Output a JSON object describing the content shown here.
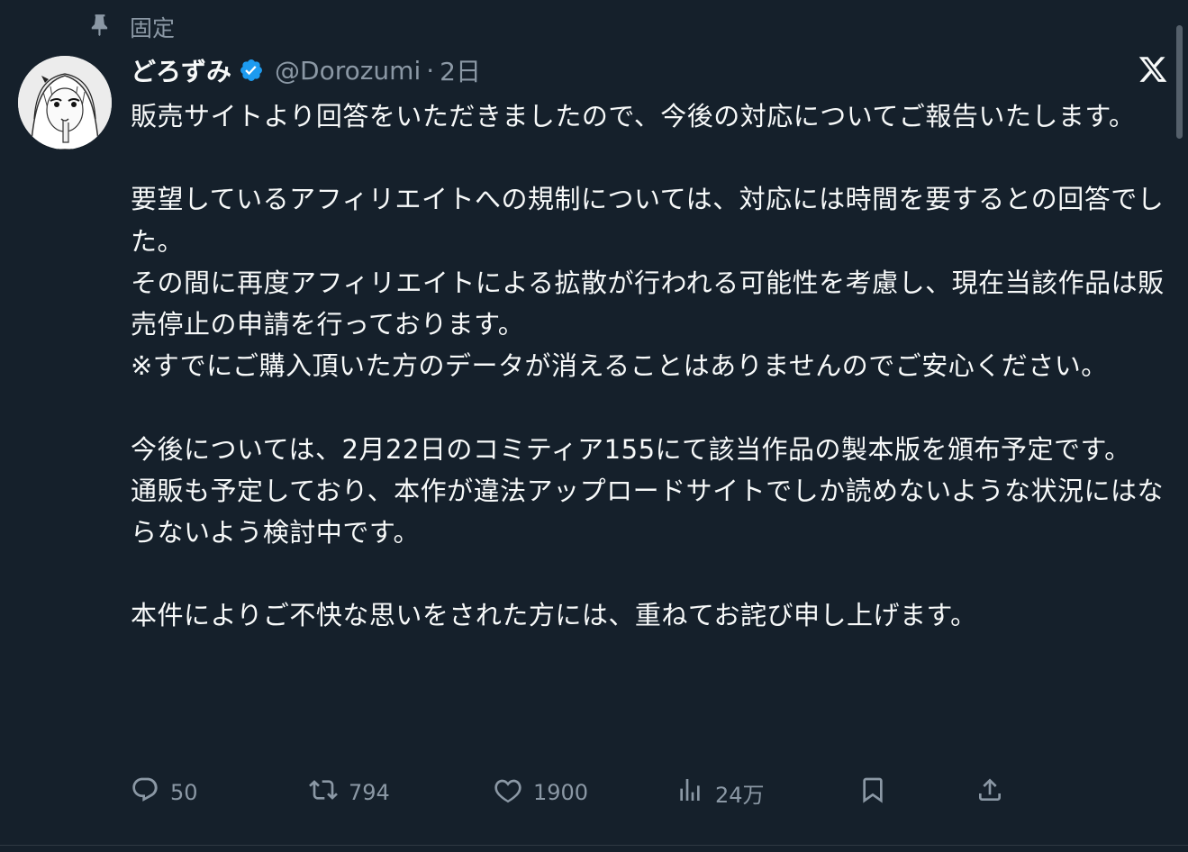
{
  "pinned": {
    "label": "固定"
  },
  "author": {
    "display_name": "どろずみ",
    "handle": "@Dorozumi",
    "separator": "·",
    "time": "2日",
    "verified": true
  },
  "tweet": {
    "paragraphs": [
      "販売サイトより回答をいただきましたので、今後の対応についてご報告いたします。",
      "",
      "要望しているアフィリエイトへの規制については、対応には時間を要するとの回答でした。",
      "その間に再度アフィリエイトによる拡散が行われる可能性を考慮し、現在当該作品は販売停止の申請を行っております。",
      "※すでにご購入頂いた方のデータが消えることはありませんのでご安心ください。",
      "",
      "今後については、2月22日のコミティア155にて該当作品の製本版を頒布予定です。",
      "通販も予定しており、本作が違法アップロードサイトでしか読めないような状況にはならないよう検討中です。",
      "",
      "本件によりご不快な思いをされた方には、重ねてお詫び申し上げます。"
    ]
  },
  "actions": {
    "reply_count": "50",
    "retweet_count": "794",
    "like_count": "1900",
    "views_count": "24万"
  },
  "icons": {
    "pin": "pin-icon",
    "verified": "verified-badge-icon",
    "brand": "x-logo-icon",
    "reply": "reply-icon",
    "retweet": "retweet-icon",
    "like": "heart-icon",
    "views": "views-icon",
    "bookmark": "bookmark-icon",
    "share": "share-icon"
  },
  "colors": {
    "background": "#15202b",
    "text": "#f7f9f9",
    "secondary": "#8b98a5",
    "verified": "#1d9bf0"
  }
}
